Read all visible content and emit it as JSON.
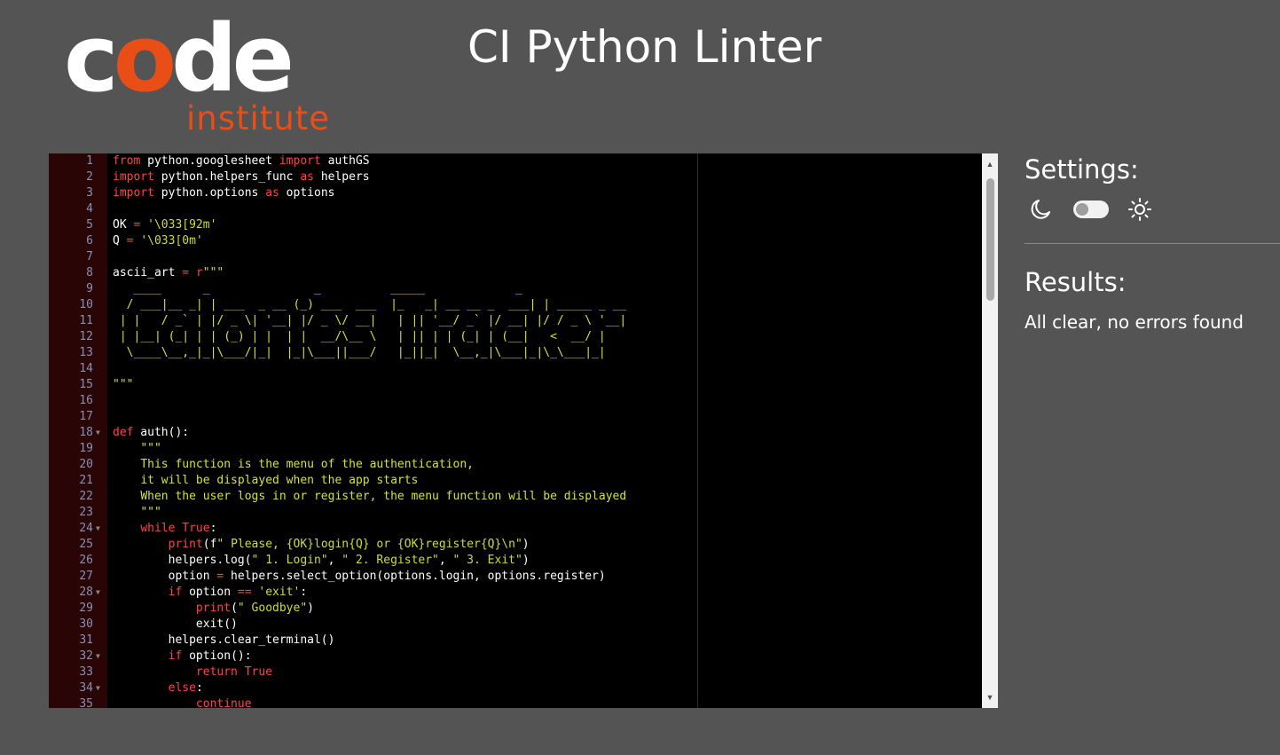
{
  "logo": {
    "text_prefix": "c",
    "text_accent": "o",
    "text_suffix": "de",
    "subtext": "institute"
  },
  "title": "CI Python Linter",
  "colors": {
    "background": "#545454",
    "accent": "#e84e16",
    "editor_bg": "#000000",
    "gutter_bg": "#2a0505",
    "keyword": "#ff4343",
    "string": "#cddc39"
  },
  "editor": {
    "lines": [
      {
        "n": "1",
        "fold": false,
        "tokens": [
          {
            "c": "kw",
            "t": "from"
          },
          {
            "c": "",
            "t": " python.googlesheet "
          },
          {
            "c": "kw",
            "t": "import"
          },
          {
            "c": "",
            "t": " authGS"
          }
        ]
      },
      {
        "n": "2",
        "fold": false,
        "tokens": [
          {
            "c": "kw",
            "t": "import"
          },
          {
            "c": "",
            "t": " python.helpers_func "
          },
          {
            "c": "kw",
            "t": "as"
          },
          {
            "c": "",
            "t": " helpers"
          }
        ]
      },
      {
        "n": "3",
        "fold": false,
        "tokens": [
          {
            "c": "kw",
            "t": "import"
          },
          {
            "c": "",
            "t": " python.options "
          },
          {
            "c": "kw",
            "t": "as"
          },
          {
            "c": "",
            "t": " options"
          }
        ]
      },
      {
        "n": "4",
        "fold": false,
        "tokens": []
      },
      {
        "n": "5",
        "fold": false,
        "tokens": [
          {
            "c": "",
            "t": "OK "
          },
          {
            "c": "kw",
            "t": "="
          },
          {
            "c": "",
            "t": " "
          },
          {
            "c": "str",
            "t": "'\\033[92m'"
          }
        ]
      },
      {
        "n": "6",
        "fold": false,
        "tokens": [
          {
            "c": "",
            "t": "Q "
          },
          {
            "c": "kw",
            "t": "="
          },
          {
            "c": "",
            "t": " "
          },
          {
            "c": "str",
            "t": "'\\033[0m'"
          }
        ]
      },
      {
        "n": "7",
        "fold": false,
        "tokens": []
      },
      {
        "n": "8",
        "fold": false,
        "tokens": [
          {
            "c": "",
            "t": "ascii_art "
          },
          {
            "c": "kw",
            "t": "="
          },
          {
            "c": "",
            "t": " "
          },
          {
            "c": "kw",
            "t": "r"
          },
          {
            "c": "str",
            "t": "\"\"\""
          }
        ]
      },
      {
        "n": "9",
        "fold": false,
        "tokens": [
          {
            "c": "doc",
            "t": "   ____      _               _          _____             _             "
          }
        ]
      },
      {
        "n": "10",
        "fold": false,
        "tokens": [
          {
            "c": "doc",
            "t": "  / ___|__ _| | ___  _ __ (_) ___  ___  |_   _| __ __ _  ___| | _____ _ __ "
          }
        ]
      },
      {
        "n": "11",
        "fold": false,
        "tokens": [
          {
            "c": "doc",
            "t": " | |   / _` | |/ _ \\| '__| |/ _ \\/ __|   | || '__/ _` |/ __| |/ / _ \\ '__|"
          }
        ]
      },
      {
        "n": "12",
        "fold": false,
        "tokens": [
          {
            "c": "doc",
            "t": " | |__| (_| | | (_) | |  | |  __/\\__ \\   | || | | (_| | (__|   <  __/ |   "
          }
        ]
      },
      {
        "n": "13",
        "fold": false,
        "tokens": [
          {
            "c": "doc",
            "t": "  \\____\\__,_|_|\\___/|_|  |_|\\___||___/   |_||_|  \\__,_|\\___|_|\\_\\___|_|   "
          }
        ]
      },
      {
        "n": "14",
        "fold": false,
        "tokens": []
      },
      {
        "n": "15",
        "fold": false,
        "tokens": [
          {
            "c": "str",
            "t": "\"\"\""
          }
        ]
      },
      {
        "n": "16",
        "fold": false,
        "tokens": []
      },
      {
        "n": "17",
        "fold": false,
        "tokens": []
      },
      {
        "n": "18",
        "fold": true,
        "tokens": [
          {
            "c": "kw",
            "t": "def"
          },
          {
            "c": "",
            "t": " auth():"
          }
        ]
      },
      {
        "n": "19",
        "fold": false,
        "tokens": [
          {
            "c": "",
            "t": "    "
          },
          {
            "c": "doc",
            "t": "\"\"\""
          }
        ]
      },
      {
        "n": "20",
        "fold": false,
        "tokens": [
          {
            "c": "",
            "t": "    "
          },
          {
            "c": "doc",
            "t": "This function is the menu of the authentication,"
          }
        ]
      },
      {
        "n": "21",
        "fold": false,
        "tokens": [
          {
            "c": "",
            "t": "    "
          },
          {
            "c": "doc",
            "t": "it will be displayed when the app starts"
          }
        ]
      },
      {
        "n": "22",
        "fold": false,
        "tokens": [
          {
            "c": "",
            "t": "    "
          },
          {
            "c": "doc",
            "t": "When the user logs in or register, the menu function will be displayed"
          }
        ]
      },
      {
        "n": "23",
        "fold": false,
        "tokens": [
          {
            "c": "",
            "t": "    "
          },
          {
            "c": "doc",
            "t": "\"\"\""
          }
        ]
      },
      {
        "n": "24",
        "fold": true,
        "tokens": [
          {
            "c": "",
            "t": "    "
          },
          {
            "c": "kw",
            "t": "while"
          },
          {
            "c": "",
            "t": " "
          },
          {
            "c": "kw",
            "t": "True"
          },
          {
            "c": "",
            "t": ":"
          }
        ]
      },
      {
        "n": "25",
        "fold": false,
        "tokens": [
          {
            "c": "",
            "t": "        "
          },
          {
            "c": "kw",
            "t": "print"
          },
          {
            "c": "",
            "t": "(f"
          },
          {
            "c": "str",
            "t": "\" Please, {OK}login{Q} or {OK}register{Q}\\n\""
          },
          {
            "c": "",
            "t": ")"
          }
        ]
      },
      {
        "n": "26",
        "fold": false,
        "tokens": [
          {
            "c": "",
            "t": "        helpers.log("
          },
          {
            "c": "str",
            "t": "\" 1. Login\""
          },
          {
            "c": "",
            "t": ", "
          },
          {
            "c": "str",
            "t": "\" 2. Register\""
          },
          {
            "c": "",
            "t": ", "
          },
          {
            "c": "str",
            "t": "\" 3. Exit\""
          },
          {
            "c": "",
            "t": ")"
          }
        ]
      },
      {
        "n": "27",
        "fold": false,
        "tokens": [
          {
            "c": "",
            "t": "        option "
          },
          {
            "c": "kw",
            "t": "="
          },
          {
            "c": "",
            "t": " helpers.select_option(options.login, options.register)"
          }
        ]
      },
      {
        "n": "28",
        "fold": true,
        "tokens": [
          {
            "c": "",
            "t": "        "
          },
          {
            "c": "kw",
            "t": "if"
          },
          {
            "c": "",
            "t": " option "
          },
          {
            "c": "kw",
            "t": "=="
          },
          {
            "c": "",
            "t": " "
          },
          {
            "c": "str",
            "t": "'exit'"
          },
          {
            "c": "",
            "t": ":"
          }
        ]
      },
      {
        "n": "29",
        "fold": false,
        "tokens": [
          {
            "c": "",
            "t": "            "
          },
          {
            "c": "kw",
            "t": "print"
          },
          {
            "c": "",
            "t": "("
          },
          {
            "c": "str",
            "t": "\" Goodbye\""
          },
          {
            "c": "",
            "t": ")"
          }
        ]
      },
      {
        "n": "30",
        "fold": false,
        "tokens": [
          {
            "c": "",
            "t": "            exit()"
          }
        ]
      },
      {
        "n": "31",
        "fold": false,
        "tokens": [
          {
            "c": "",
            "t": "        helpers.clear_terminal()"
          }
        ]
      },
      {
        "n": "32",
        "fold": true,
        "tokens": [
          {
            "c": "",
            "t": "        "
          },
          {
            "c": "kw",
            "t": "if"
          },
          {
            "c": "",
            "t": " option():"
          }
        ]
      },
      {
        "n": "33",
        "fold": false,
        "tokens": [
          {
            "c": "",
            "t": "            "
          },
          {
            "c": "kw",
            "t": "return"
          },
          {
            "c": "",
            "t": " "
          },
          {
            "c": "kw",
            "t": "True"
          }
        ]
      },
      {
        "n": "34",
        "fold": true,
        "tokens": [
          {
            "c": "",
            "t": "        "
          },
          {
            "c": "kw",
            "t": "else"
          },
          {
            "c": "",
            "t": ":"
          }
        ]
      },
      {
        "n": "35",
        "fold": false,
        "tokens": [
          {
            "c": "",
            "t": "            "
          },
          {
            "c": "kw",
            "t": "continue"
          }
        ]
      }
    ]
  },
  "settings": {
    "title": "Settings:",
    "dark_icon": "moon-icon",
    "toggle_state": "off",
    "light_icon": "sun-icon"
  },
  "results": {
    "title": "Results:",
    "message": "All clear, no errors found"
  }
}
